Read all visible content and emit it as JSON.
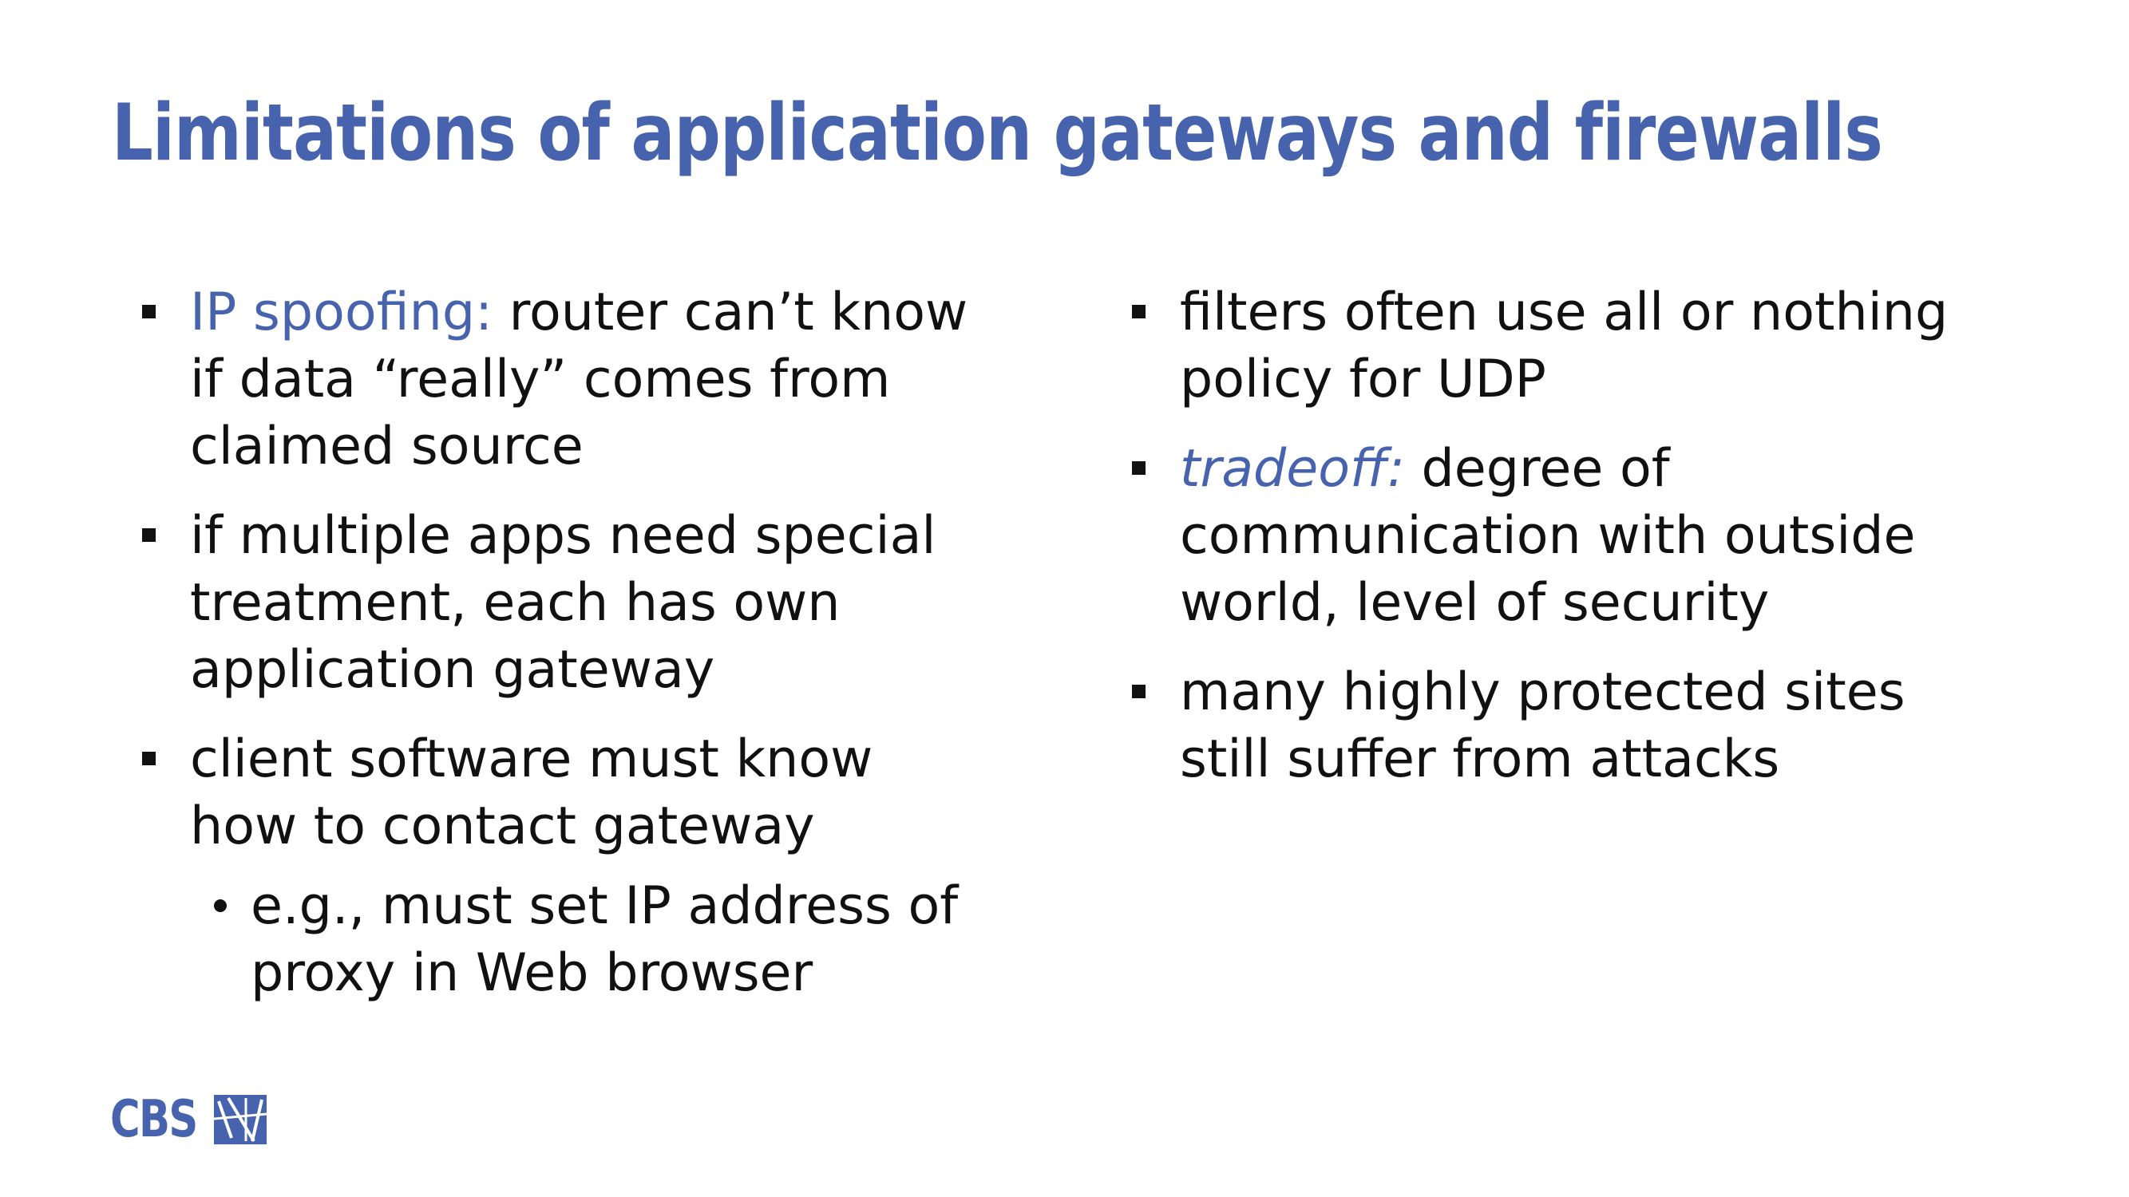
{
  "slide": {
    "title": "Limitations of application gateways and firewalls",
    "accent_color": "#4763AE",
    "left_column": {
      "bullets": [
        {
          "lead": "IP spoofing:",
          "lines": [
            " router can’t know",
            "if data “really” comes from",
            "claimed source"
          ]
        },
        {
          "lines": [
            "if multiple apps need special",
            "treatment, each has own",
            "application gateway"
          ]
        },
        {
          "lines": [
            "client software must know",
            "how to contact gateway"
          ],
          "sub": [
            "e.g., must set IP address of",
            "proxy in Web browser"
          ]
        }
      ]
    },
    "right_column": {
      "bullets": [
        {
          "lines": [
            "filters often use all or nothing",
            "policy for UDP"
          ]
        },
        {
          "lead": "tradeoff:",
          "lines": "  degree of,communication with outside,world, level of security"
        },
        {
          "lines": [
            "many highly protected sites",
            "still suffer from attacks"
          ]
        }
      ]
    },
    "logo": {
      "text": "CBS",
      "icon": "cbs-logo-mark-icon"
    }
  }
}
